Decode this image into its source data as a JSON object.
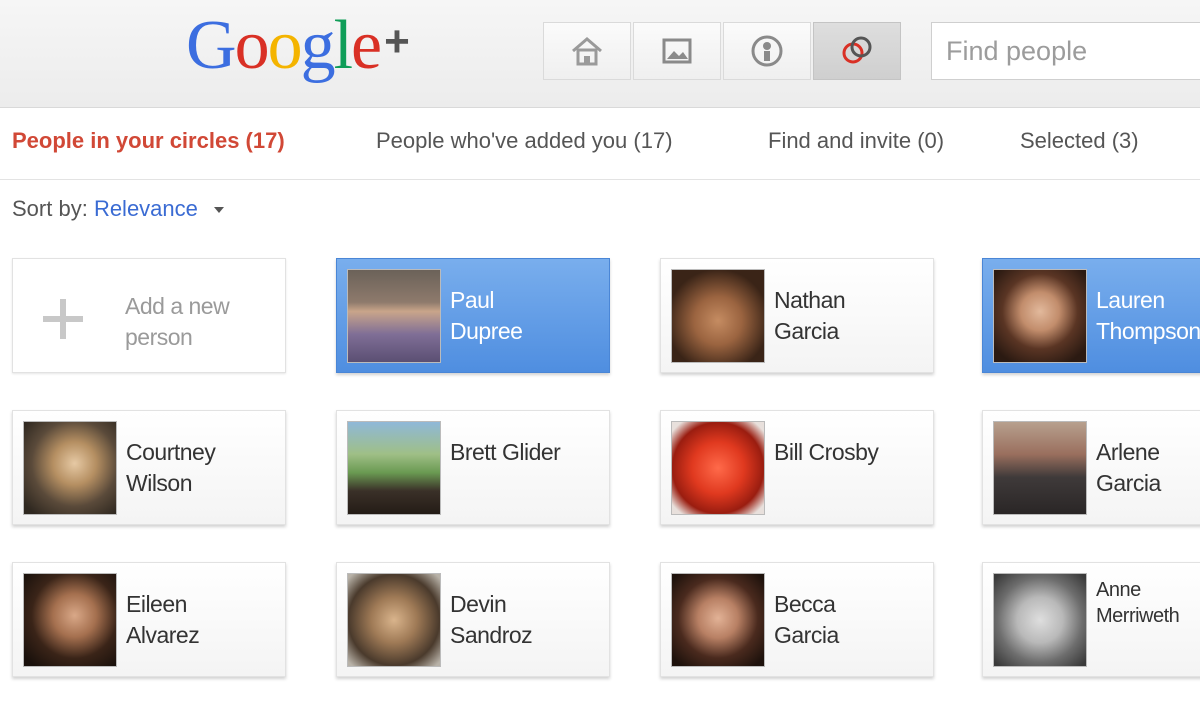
{
  "logo": {
    "word": "Google",
    "plus": "+"
  },
  "nav": {
    "items": [
      {
        "icon": "home-icon"
      },
      {
        "icon": "photos-icon"
      },
      {
        "icon": "profile-icon"
      },
      {
        "icon": "circles-icon",
        "active": true
      }
    ]
  },
  "search": {
    "placeholder": "Find people"
  },
  "tabs": {
    "people_in_circles": "People in your circles (17)",
    "added_you": "People who've added you (17)",
    "find_invite": "Find and invite (0)",
    "selected": "Selected (3)"
  },
  "sort": {
    "label": "Sort by:",
    "value": "Relevance"
  },
  "add_person": {
    "label": "Add a new person"
  },
  "people": [
    {
      "first": "Paul",
      "last": "Dupree",
      "selected": true
    },
    {
      "first": "Nathan",
      "last": "Garcia",
      "selected": false
    },
    {
      "first": "Lauren",
      "last": "Thompson",
      "selected": true
    },
    {
      "first": "Courtney",
      "last": "Wilson",
      "selected": false
    },
    {
      "first": "Brett Glider",
      "last": "",
      "selected": false
    },
    {
      "first": "Bill Crosby",
      "last": "",
      "selected": false
    },
    {
      "first": "Arlene",
      "last": "Garcia",
      "selected": false
    },
    {
      "first": "Eileen",
      "last": "Alvarez",
      "selected": false
    },
    {
      "first": "Devin",
      "last": "Sandroz",
      "selected": false
    },
    {
      "first": "Becca",
      "last": "Garcia",
      "selected": false
    },
    {
      "first": "Anne",
      "last": "Merriweth",
      "selected": false
    }
  ],
  "colors": {
    "accent_red": "#d14836",
    "link_blue": "#3a6bd3",
    "selected_blue": "#5b97e3"
  }
}
